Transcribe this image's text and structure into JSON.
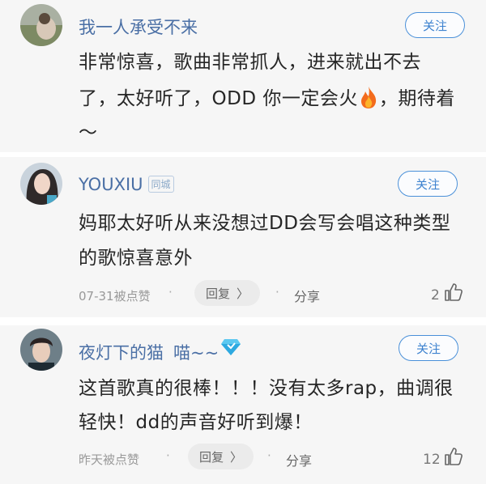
{
  "comments": [
    {
      "username": "我一人承受不来",
      "follow_label": "关注",
      "text_lines": [
        "非常惊喜，歌曲非常抓人，进来就出不去",
        "了，太好听了，ODD 你一定会火",
        "，期待着",
        "～"
      ],
      "fire_icon": "fire-emoji-icon"
    },
    {
      "username": "YOUXIU",
      "city_badge": "同城",
      "follow_label": "关注",
      "text_lines": [
        "妈耶太好听从来没想过DD会写会唱这种类型",
        "的歌惊喜意外"
      ],
      "timestamp": "07-31被点赞",
      "reply_label": "回复",
      "share_label": "分享",
      "like_count": "2"
    },
    {
      "username": "夜灯下的猫",
      "username_suffix": "喵~~",
      "follow_label": "关注",
      "text_lines": [
        "这首歌真的很棒！！！没有太多rap，曲调很",
        "轻快！dd的声音好听到爆！"
      ],
      "timestamp": "昨天被点赞",
      "reply_label": "回复",
      "share_label": "分享",
      "like_count": "12"
    }
  ],
  "colors": {
    "card_bg": "#f6f6f6",
    "username": "#4a6fa5",
    "follow_border": "#4a90d9",
    "text": "#262626",
    "meta": "#999999"
  }
}
